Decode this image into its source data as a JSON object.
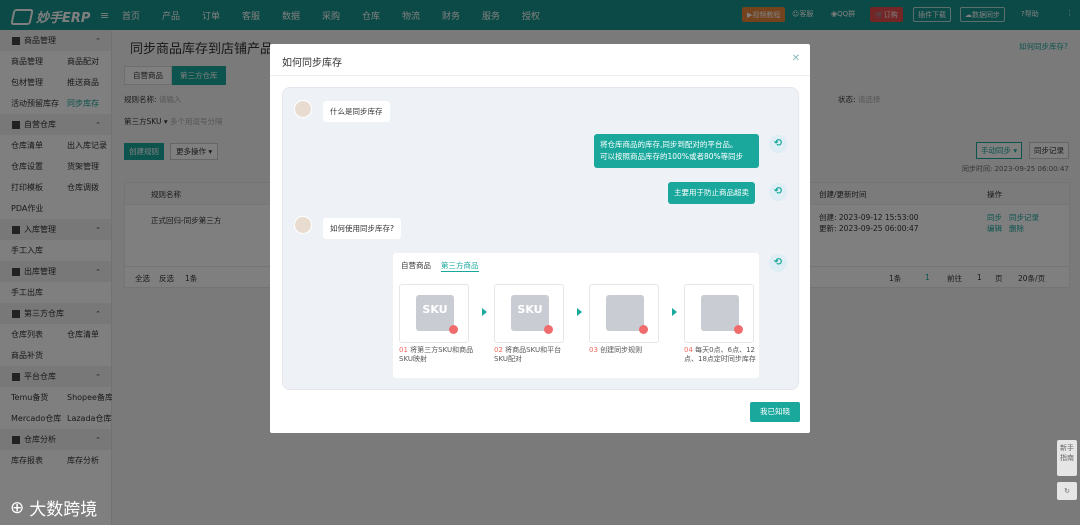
{
  "app": {
    "logo": "妙手ERP"
  },
  "nav": [
    "首页",
    "产品",
    "订单",
    "客服",
    "数据",
    "采购",
    "仓库",
    "物流",
    "财务",
    "服务",
    "授权"
  ],
  "topright": {
    "tutorial": "视频教程",
    "service": "客服",
    "qq": "QQ群",
    "order": "订购",
    "plugin": "插件下载",
    "sync": "数据同步",
    "help": "帮助"
  },
  "sidebar": [
    {
      "group": "商品管理",
      "items": [
        "商品管理",
        "商品配对",
        "包材管理",
        "推送商品",
        "活动预留库存",
        "同步库存"
      ]
    },
    {
      "group": "自营仓库",
      "items": [
        "仓库清单",
        "出入库记录",
        "仓库设置",
        "货架管理",
        "打印模板",
        "仓库调拨",
        "PDA作业"
      ]
    },
    {
      "group": "入库管理",
      "items": [
        "手工入库"
      ]
    },
    {
      "group": "出库管理",
      "items": [
        "手工出库"
      ]
    },
    {
      "group": "第三方仓库",
      "items": [
        "仓库列表",
        "仓库清单",
        "商品补货"
      ]
    },
    {
      "group": "平台仓库",
      "items": [
        "Temu备货",
        "Shopee备库",
        "Mercado仓库",
        "Lazada仓库"
      ]
    },
    {
      "group": "仓库分析",
      "items": [
        "库存报表",
        "库存分析"
      ]
    }
  ],
  "page": {
    "title": "同步商品库存到店铺产品",
    "help_link": "如何同步库存?",
    "tab1": "自营商品",
    "tab2": "第三方仓库",
    "rule_label": "规则名称:",
    "rule_ph": "请输入",
    "sku_select": "第三方SKU",
    "sku_ph": "多个用逗号分隔",
    "status_label": "状态:",
    "status_ph": "请选择",
    "create_btn": "创建规则",
    "more_btn": "更多操作",
    "manual_sync": "手动同步",
    "sync_log": "同步记录",
    "sync_time": "同步时间: 2023-09-25 06:00:47",
    "col_rule": "规则名称",
    "col_date": "创建/更新时间",
    "col_op": "操作",
    "row_name": "正式回归-同步第三方",
    "row_created": "创建: 2023-09-12 15:53:00",
    "row_updated": "更新: 2023-09-25 06:00:47",
    "op_sync": "同步",
    "op_log": "同步记录",
    "op_edit": "编辑",
    "op_del": "删除",
    "sel_all": "全选",
    "sel_inv": "反选",
    "count": "1条",
    "pg_total": "1条",
    "pg_cur": "1",
    "pg_goto": "前往",
    "pg_num": "1",
    "pg_unit": "页",
    "pg_size": "20条/页"
  },
  "modal": {
    "title": "如何同步库存",
    "q1": "什么是同步库存",
    "a1_l1": "将仓库商品的库存,同步到配对的平台品。",
    "a1_l2": "可以按照商品库存的100%或者80%等同步",
    "a2": "主要用于防止商品超卖",
    "q2": "如何使用同步库存?",
    "tab1": "自营商品",
    "tab2": "第三方商品",
    "steps": [
      {
        "num": "01",
        "text": "将第三方SKU和商品SKU映射",
        "icon": "SKU"
      },
      {
        "num": "02",
        "text": "将商品SKU和平台SKU配对",
        "icon": "SKU"
      },
      {
        "num": "03",
        "text": "创建同步规则",
        "icon": ""
      },
      {
        "num": "04",
        "text": "每天0点、6点、12点、18点定时同步库存",
        "icon": ""
      }
    ],
    "ok": "我已知晓"
  },
  "side_tools": {
    "news": "新手指南"
  },
  "watermark": "大数跨境"
}
